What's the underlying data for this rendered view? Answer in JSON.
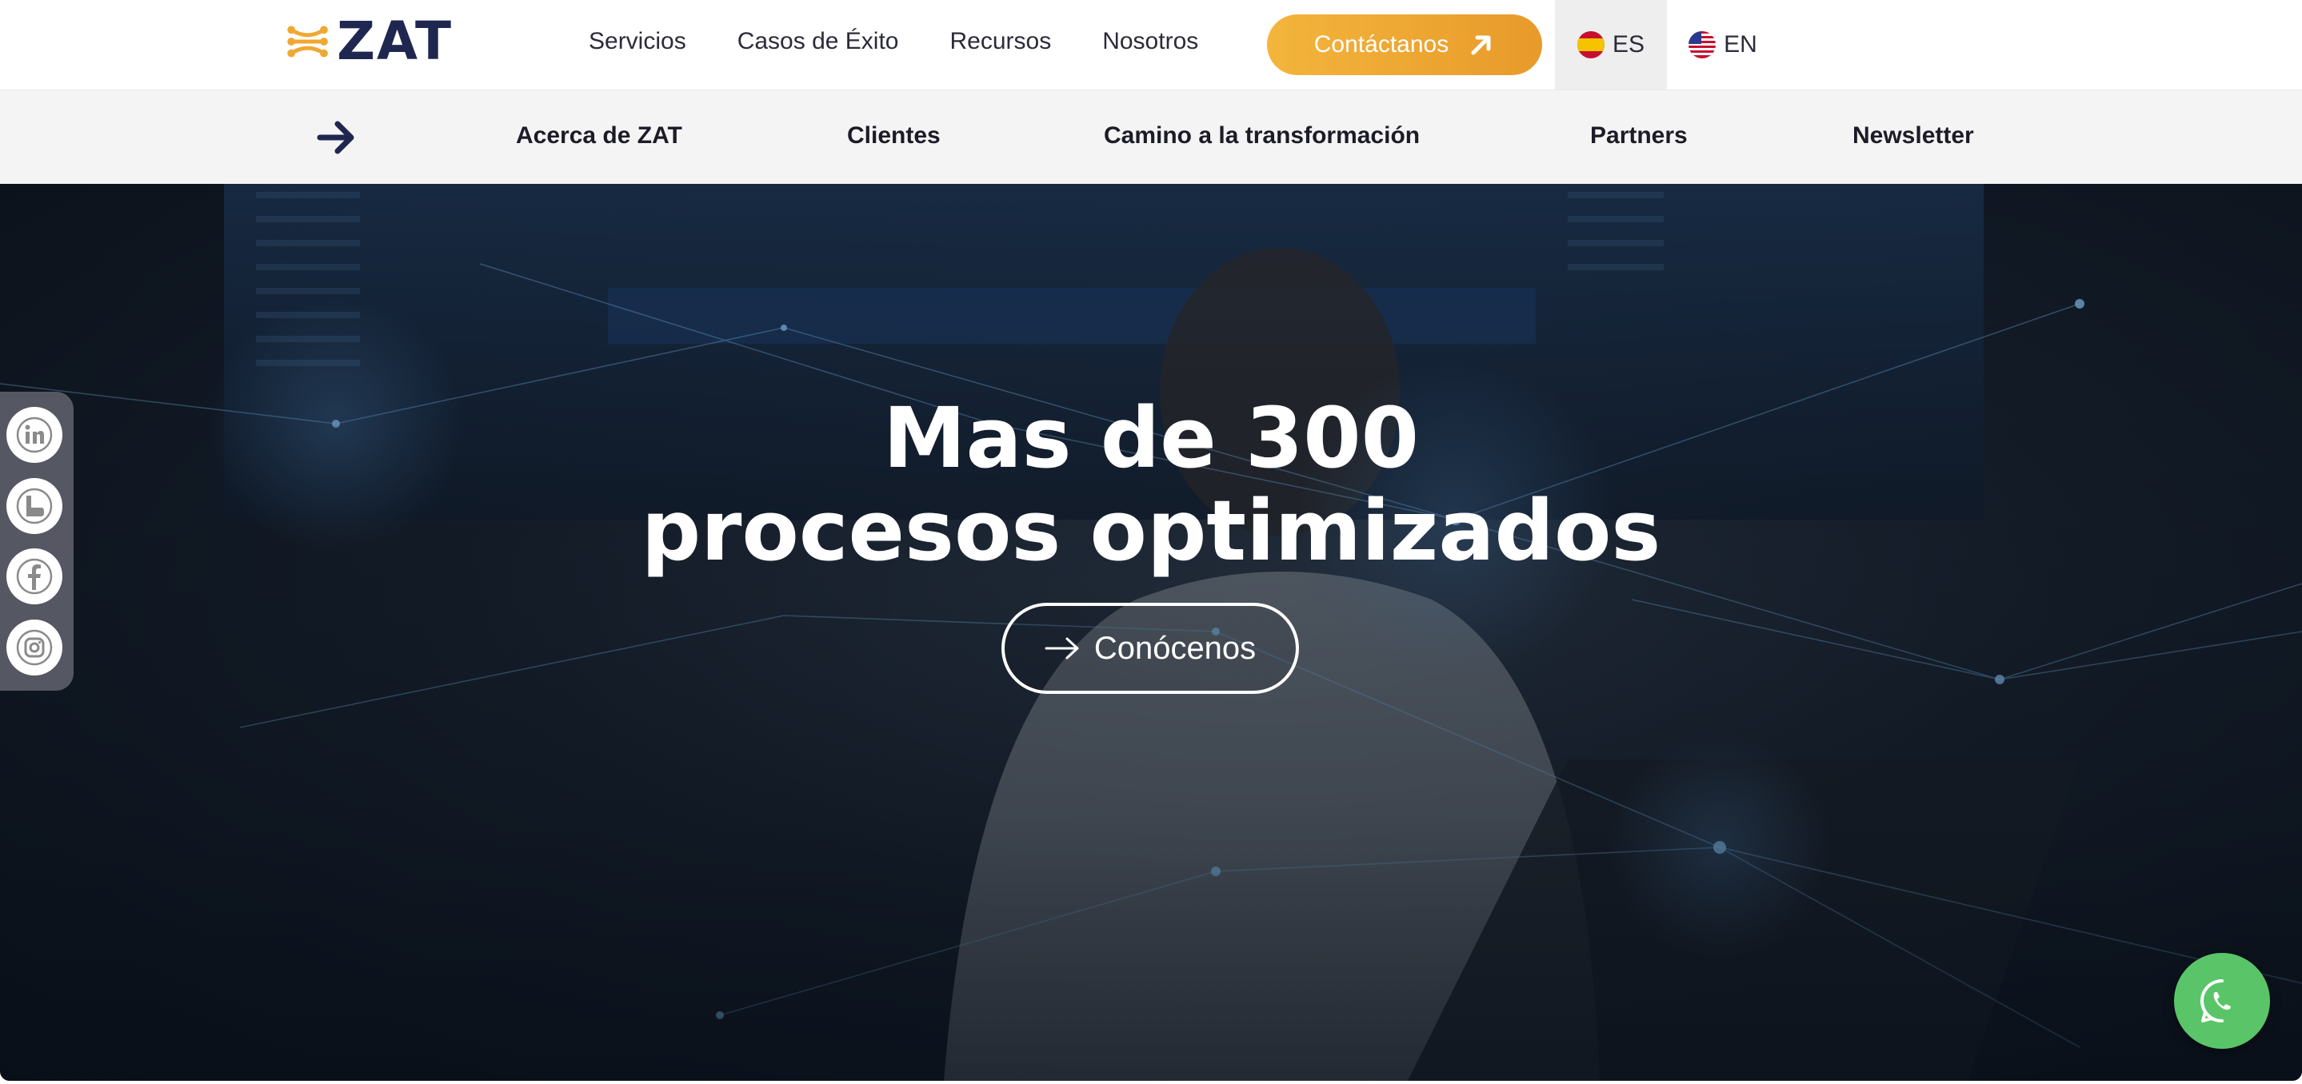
{
  "brand": {
    "name": "ZAT",
    "accent": "#f0a833",
    "navy": "#1f2750"
  },
  "nav": {
    "items": [
      "Servicios",
      "Casos de Éxito",
      "Recursos",
      "Nosotros"
    ],
    "cta_label": "Contáctanos",
    "cta_icon": "arrow-up-right-icon",
    "languages": [
      {
        "code": "ES",
        "flag": "spain-flag-icon",
        "active": true
      },
      {
        "code": "EN",
        "flag": "usa-flag-icon",
        "active": false
      }
    ]
  },
  "subnav": {
    "arrow_icon": "arrow-right-icon",
    "items": [
      "Acerca de ZAT",
      "Clientes",
      "Camino a la transformación",
      "Partners",
      "Newsletter"
    ]
  },
  "hero": {
    "title_line1": "Mas de 300",
    "title_line2": "procesos optimizados",
    "button_label": "Conócenos",
    "button_icon": "arrow-right-icon"
  },
  "social": [
    {
      "name": "linkedin",
      "icon": "linkedin-icon"
    },
    {
      "name": "behance",
      "icon": "behance-icon"
    },
    {
      "name": "facebook",
      "icon": "facebook-icon"
    },
    {
      "name": "instagram",
      "icon": "instagram-icon"
    }
  ],
  "whatsapp": {
    "icon": "whatsapp-icon",
    "color": "#5ac568"
  }
}
